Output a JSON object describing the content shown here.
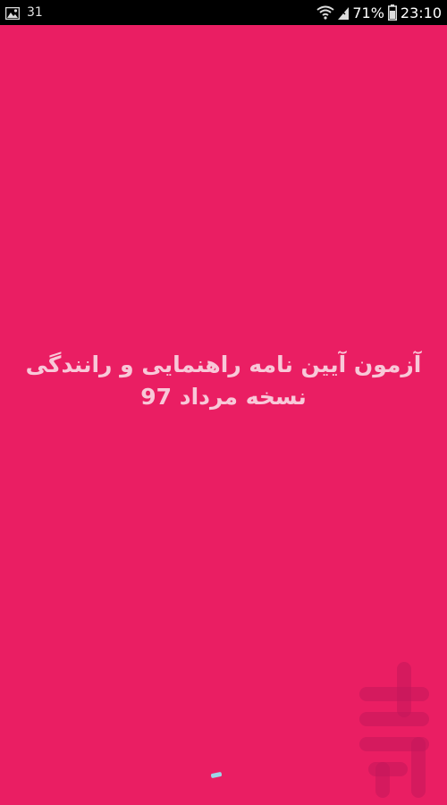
{
  "status_bar": {
    "notification_count": "31",
    "battery_percent": "71%",
    "time": "23:10",
    "icons": [
      "gallery-icon",
      "wifi-icon",
      "battery-icon"
    ]
  },
  "splash": {
    "title_line1": "آزمون آیین نامه راهنمایی و رانندگی",
    "title_line2": "نسخه مرداد 97",
    "background_color": "#ea1e63",
    "text_color": "#f8c8d8",
    "logo": "cafe-bazaar-logo"
  }
}
